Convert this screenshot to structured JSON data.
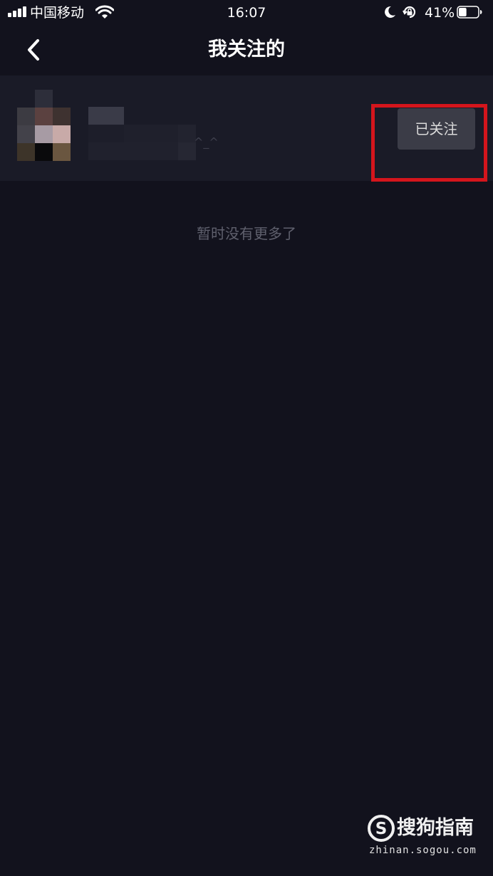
{
  "status_bar": {
    "carrier": "中国移动",
    "time": "16:07",
    "battery_percent": "41%",
    "battery_level": 0.41,
    "icons": [
      "signal-icon",
      "wifi-icon",
      "moon-icon",
      "rotation-lock-icon",
      "battery-icon"
    ]
  },
  "nav": {
    "back_icon": "chevron-left-icon",
    "title": "我关注的"
  },
  "following_list": [
    {
      "avatar": "pixelated-avatar",
      "name_visible": "^_^",
      "follow_button_label": "已关注"
    }
  ],
  "empty_message": "暂时没有更多了",
  "annotation": {
    "highlight_color": "#d4151c"
  },
  "watermark": {
    "brand": "搜狗指南",
    "url": "zhinan.sogou.com"
  },
  "colors": {
    "background": "#12121d",
    "row_background": "#1a1b27",
    "button_background": "#3b3c47"
  }
}
